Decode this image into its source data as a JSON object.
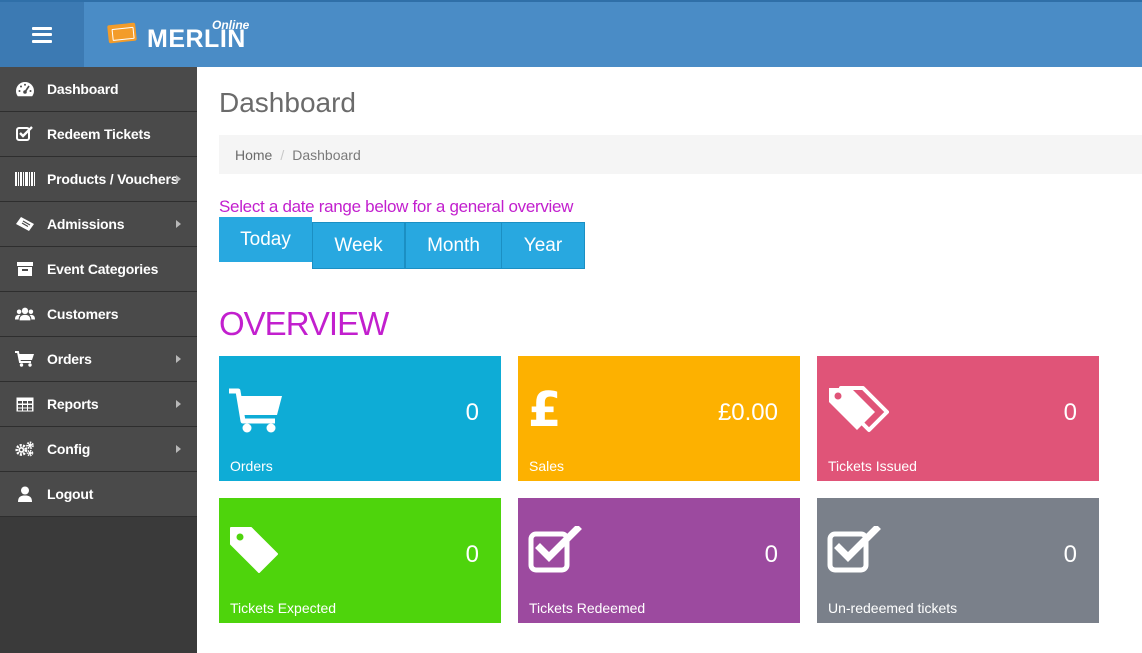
{
  "header": {
    "brand": "MERLIN",
    "brand_sub": "Online",
    "accent": "#4a8cc6",
    "menu_icon": "hamburger-icon"
  },
  "sidebar": {
    "items": [
      {
        "label": "Dashboard",
        "icon": "dashboard-icon",
        "submenu": false
      },
      {
        "label": "Redeem Tickets",
        "icon": "checkbox-icon",
        "submenu": false
      },
      {
        "label": "Products / Vouchers",
        "icon": "barcode-icon",
        "submenu": true
      },
      {
        "label": "Admissions",
        "icon": "ticket-icon",
        "submenu": true
      },
      {
        "label": "Event Categories",
        "icon": "archive-icon",
        "submenu": false
      },
      {
        "label": "Customers",
        "icon": "users-icon",
        "submenu": false
      },
      {
        "label": "Orders",
        "icon": "cart-icon",
        "submenu": true
      },
      {
        "label": "Reports",
        "icon": "table-icon",
        "submenu": true
      },
      {
        "label": "Config",
        "icon": "gears-icon",
        "submenu": true
      },
      {
        "label": "Logout",
        "icon": "user-icon",
        "submenu": false
      }
    ]
  },
  "main": {
    "title": "Dashboard",
    "breadcrumb": {
      "home": "Home",
      "separator": "/",
      "current": "Dashboard"
    },
    "range_prompt": "Select a date range below for a general overview",
    "range_buttons": [
      {
        "label": "Today",
        "active": true
      },
      {
        "label": "Week",
        "active": false
      },
      {
        "label": "Month",
        "active": false
      },
      {
        "label": "Year",
        "active": false
      }
    ],
    "overview_title": "OVERVIEW",
    "tiles": [
      {
        "label": "Orders",
        "value": "0",
        "color": "#0eacd6",
        "icon": "cart-icon"
      },
      {
        "label": "Sales",
        "value": "£0.00",
        "color": "#fdb100",
        "icon": "pound-icon"
      },
      {
        "label": "Tickets Issued",
        "value": "0",
        "color": "#e05478",
        "icon": "tags-icon"
      },
      {
        "label": "Tickets Expected",
        "value": "0",
        "color": "#4ed40c",
        "icon": "tag-icon"
      },
      {
        "label": "Tickets Redeemed",
        "value": "0",
        "color": "#9c4a9f",
        "icon": "checkbox-icon"
      },
      {
        "label": "Un-redeemed tickets",
        "value": "0",
        "color": "#7a808a",
        "icon": "checkbox-icon"
      }
    ]
  }
}
